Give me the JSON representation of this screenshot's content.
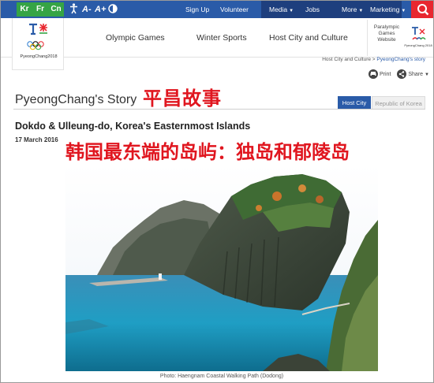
{
  "topbar": {
    "languages": [
      "Kr",
      "Fr",
      "Cn"
    ],
    "accessibility": [
      "A-",
      "A+"
    ],
    "links": [
      "Sign Up",
      "Volunteer"
    ],
    "menus": [
      "Media",
      "Jobs",
      "More",
      "Marketing"
    ]
  },
  "header": {
    "logo_text": "PyeongChang2018",
    "nav": [
      "Olympic Games",
      "Winter Sports",
      "Host City and Culture"
    ],
    "paralympic_link": "Paralympic Games Website",
    "paralympic_logo_text": "PyeongChang 2018"
  },
  "breadcrumb": {
    "parent": "Host City and Culture",
    "separator": ">",
    "current": "PyeongChang's story"
  },
  "tools": {
    "print": "Print",
    "share": "Share"
  },
  "section": {
    "title": "PyeongChang's Story",
    "overlay_cn": "平昌故事",
    "tabs": [
      "Host City",
      "Republic of Korea"
    ]
  },
  "article": {
    "title": "Dokdo & Ulleung-do, Korea's Easternmost Islands",
    "date": "17 March 2016",
    "overlay_cn": "韩国最东端的岛屿：独岛和郁陵岛"
  },
  "photo": {
    "caption": "Photo: Haengnam Coastal Walking Path (Dodong)"
  },
  "colors": {
    "topbar": "#2a5ba8",
    "language_green": "#35a445",
    "search_red": "#e8272f",
    "overlay_red": "#e0161f"
  }
}
